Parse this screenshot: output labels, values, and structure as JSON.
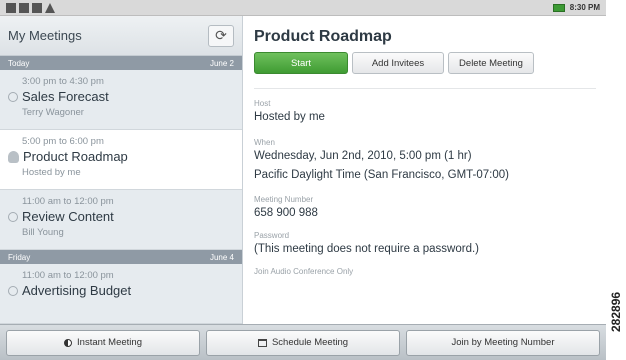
{
  "status_bar": {
    "time": "8:30 PM",
    "icons": [
      "download-icon",
      "download-icon",
      "image-icon",
      "warning-icon"
    ]
  },
  "sidebar": {
    "title": "My Meetings",
    "refresh_icon": "refresh-icon",
    "sections": [
      {
        "label": "Today",
        "date": "June 2",
        "meetings": [
          {
            "time": "3:00 pm to 4:30 pm",
            "title": "Sales Forecast",
            "host": "Terry Wagoner",
            "icon": "circle-icon",
            "selected": false
          },
          {
            "time": "5:00 pm to 6:00 pm",
            "title": "Product Roadmap",
            "host": "Hosted by me",
            "icon": "person-icon",
            "selected": true
          },
          {
            "time": "11:00 am to 12:00 pm",
            "title": "Review Content",
            "host": "Bill Young",
            "icon": "circle-icon",
            "selected": false
          }
        ]
      },
      {
        "label": "Friday",
        "date": "June 4",
        "meetings": [
          {
            "time": "11:00 am to 12:00 pm",
            "title": "Advertising Budget",
            "host": "",
            "icon": "circle-icon",
            "selected": false
          }
        ]
      }
    ]
  },
  "detail": {
    "title": "Product Roadmap",
    "buttons": {
      "start": "Start",
      "add_invitees": "Add Invitees",
      "delete": "Delete Meeting"
    },
    "host_label": "Host",
    "host_value": "Hosted by me",
    "when_label": "When",
    "when_value": "Wednesday, Jun 2nd, 2010, 5:00 pm (1 hr)",
    "when_tz": "Pacific Daylight Time (San Francisco, GMT-07:00)",
    "number_label": "Meeting Number",
    "number_value": "658 900 988",
    "password_label": "Password",
    "password_value": "(This meeting does not require a password.)",
    "audio_label": "Join Audio Conference Only"
  },
  "bottom_bar": {
    "instant": "Instant Meeting",
    "schedule": "Schedule Meeting",
    "join": "Join by Meeting Number"
  },
  "figure_number": "282896"
}
